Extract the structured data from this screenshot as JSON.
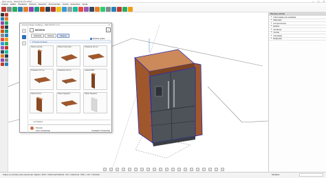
{
  "titlebar": {
    "title": "Sem nome - SketchUp Pro 2021",
    "min": "—",
    "max": "▢",
    "close": "✕"
  },
  "menubar": [
    "Arquivo",
    "Editar",
    "Visualizar",
    "Câmera",
    "Desenho",
    "Ferramentas",
    "Janela",
    "Extensões",
    "Ajuda"
  ],
  "toolbar_colors": [
    "#c0392b",
    "#7f8c8d",
    "#27ae60",
    "#2980b9",
    "#e67e22",
    "#8e44ad",
    "#16a085",
    "#d35400",
    "#2c3e50",
    "#c0392b",
    "#f1c40f",
    "#3498db",
    "#95a5a6",
    "#1abc9c",
    "#e74c3c",
    "#9b59b6",
    "#34495e",
    "#e67e22",
    "#2ecc71",
    "#7f8c8d",
    "#2980b9",
    "#c0392b",
    "#27ae60",
    "#f39c12"
  ],
  "lefttools_colors": [
    "#333",
    "#c0392b",
    "#2980b9",
    "#e67e22",
    "#8e44ad",
    "#27ae60",
    "#c0392b",
    "#2c3e50",
    "#d35400",
    "#16a085",
    "#7f8c8d",
    "#2980b9",
    "#e74c3c",
    "#f39c12",
    "#3498db",
    "#27ae60",
    "#9b59b6",
    "#c0392b",
    "#34495e",
    "#1abc9c",
    "#e67e22",
    "#2c3e50",
    "#8e44ad",
    "#7f8c8d",
    "#c0392b",
    "#2980b9"
  ],
  "rightpanel": {
    "header": "Bandeja padrão",
    "rows": [
      "Informações da entidade",
      "Materiais",
      "Componentes",
      "Estilos",
      "Sombras",
      "Cenas",
      "Camadas",
      "Etiquetas"
    ]
  },
  "dialog": {
    "title": "Promob Plugin Catálogo - SKETCHUP 2.1.0",
    "close": "✕",
    "header": "MÓVEIS",
    "header_btn": "⌂",
    "tabs": [
      "Gabinete",
      "Móveis",
      "Objetos"
    ],
    "active_tab": 2,
    "checkbox_label": "Mostrar grade",
    "section": "Peças Avulsas",
    "cards": [
      {
        "label": "Painel vertical...",
        "kind": "panel-v"
      },
      {
        "label": "Painel horizontal...",
        "kind": "panel-h"
      },
      {
        "label": "Prateleira 18 mm",
        "kind": "shelf"
      },
      {
        "label": "Prateleira 15 mm",
        "kind": "shelf"
      },
      {
        "label": "Prateleira 18 mm",
        "kind": "shelf-thin"
      },
      {
        "label": "Lateral MDF",
        "kind": "panel-v"
      },
      {
        "label": "Painel 10mm",
        "kind": "panel-v2"
      },
      {
        "label": "Painel Negativo",
        "kind": "shelf"
      },
      {
        "label": "Painel Negativo",
        "kind": "panel-light"
      }
    ],
    "dropdown": "Armários",
    "footer": {
      "user": "Promob",
      "user_sub": "User: Powerdrop",
      "right": "Unidades: Powerdrop"
    }
  },
  "viewport": {
    "colors": {
      "fridge_body": "#4e535a",
      "fridge_dark": "#3a3e44",
      "wood": "#a0572c",
      "wood_dark": "#7d4220",
      "top": "#cc8a5a",
      "selection": "#2a2ab0"
    }
  },
  "statusbar": {
    "hint": "Clique ou arraste para selecionar objetos. Shift = Adicionar/Subtrair. Ctrl = Adicionar. Shift + Ctrl = Subtrair.",
    "measure_label": "Medidas"
  }
}
